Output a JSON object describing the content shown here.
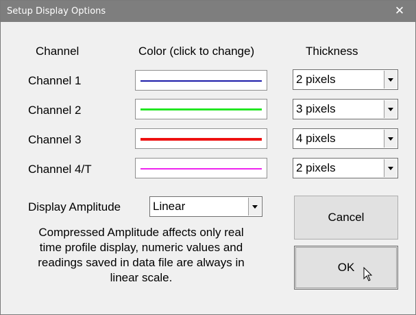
{
  "window": {
    "title": "Setup Display Options",
    "close_glyph": "✕"
  },
  "headers": {
    "channel": "Channel",
    "color": "Color (click to change)",
    "thickness": "Thickness"
  },
  "channels": [
    {
      "label": "Channel 1",
      "color": "#1a1aa8",
      "thickness": "2 pixels"
    },
    {
      "label": "Channel 2",
      "color": "#22e622",
      "thickness": "3 pixels"
    },
    {
      "label": "Channel 3",
      "color": "#ee1111",
      "thickness": "4 pixels"
    },
    {
      "label": "Channel 4/T",
      "color": "#ee22ee",
      "thickness": "2 pixels"
    }
  ],
  "amplitude": {
    "label": "Display Amplitude",
    "value": "Linear"
  },
  "note": "Compressed Amplitude affects only real time profile display, numeric values and readings saved in data file are always in linear scale.",
  "buttons": {
    "cancel": "Cancel",
    "ok": "OK"
  }
}
